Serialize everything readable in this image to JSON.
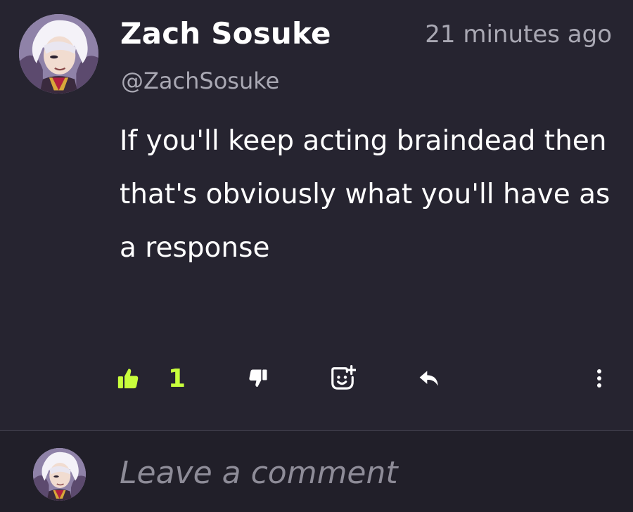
{
  "comment": {
    "author_name": "Zach Sosuke",
    "author_handle": "@ZachSosuke",
    "timestamp": "21 minutes ago",
    "body": "If you'll keep acting braindead then that's obviously what you'll have as a response"
  },
  "actions": {
    "like_count": "1",
    "like_icon": "thumbs-up-icon",
    "dislike_icon": "thumbs-down-icon",
    "react_icon": "add-reaction-icon",
    "reply_icon": "reply-icon",
    "more_icon": "more-vertical-icon"
  },
  "composer": {
    "placeholder": "Leave a comment"
  },
  "colors": {
    "background": "#262430",
    "composer_background": "#211f29",
    "accent_like": "#c8ff3c",
    "text_primary": "#ffffff",
    "text_secondary": "#a9a8b3"
  }
}
